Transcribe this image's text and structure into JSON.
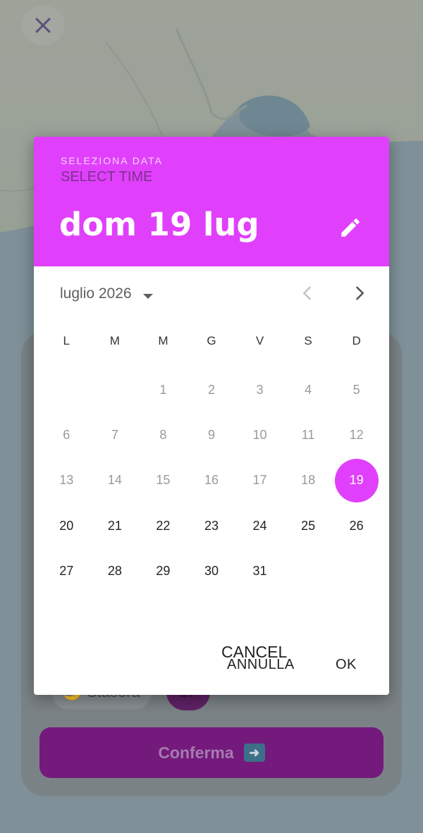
{
  "background": {
    "close_icon": "close-icon",
    "chip_tonight": "🌙 Stasera",
    "chip_date": "17",
    "confirm_label": "Conferma",
    "confirm_icon": "arrow-right-icon"
  },
  "dialog": {
    "overline": "SELEZIONA DATA",
    "time_hint": "SELECT TIME",
    "selected_date": "dom 19 lug",
    "edit_icon": "pencil-icon",
    "month_label": "luglio 2026",
    "weekdays": [
      "L",
      "M",
      "M",
      "G",
      "V",
      "S",
      "D"
    ],
    "days": {
      "leading_blanks": 2,
      "selected": 19,
      "first_enabled": 19,
      "list": [
        "1",
        "2",
        "3",
        "4",
        "5",
        "6",
        "7",
        "8",
        "9",
        "10",
        "11",
        "12",
        "13",
        "14",
        "15",
        "16",
        "17",
        "18",
        "19",
        "20",
        "21",
        "22",
        "23",
        "24",
        "25",
        "26",
        "27",
        "28",
        "29",
        "30",
        "31"
      ]
    },
    "cancel_label": "CANCEL",
    "annulla_label": "ANNULLA",
    "ok_label": "OK"
  },
  "colors": {
    "accent": "#e040fb",
    "confirm_dimmed": "#741a7c"
  }
}
